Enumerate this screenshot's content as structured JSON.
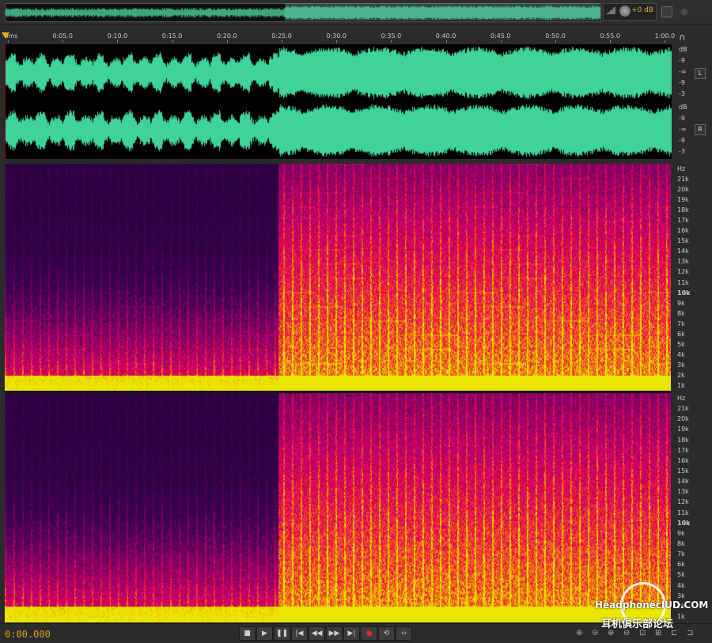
{
  "overview": {
    "volume_label": "+0 dB"
  },
  "ruler": {
    "ticks": [
      "hms",
      "0:05.0",
      "0:10.0",
      "0:15.0",
      "0:20.0",
      "0:25.0",
      "0:30.0",
      "0:35.0",
      "0:40.0",
      "0:45.0",
      "0:50.0",
      "0:55.0",
      "1:00.0"
    ]
  },
  "waveform": {
    "color": "#3fd39a",
    "db_labels": [
      "dB",
      "-9",
      "-∞",
      "-9",
      "-3"
    ],
    "left_channel": "L",
    "right_channel": "R"
  },
  "spectrogram": {
    "hz_labels": [
      "Hz",
      "21k",
      "20k",
      "19k",
      "18k",
      "17k",
      "16k",
      "15k",
      "14k",
      "13k",
      "12k",
      "11k",
      "10k",
      "9k",
      "8k",
      "7k",
      "6k",
      "5k",
      "4k",
      "3k",
      "2k",
      "1k"
    ],
    "bold_label": "10k"
  },
  "transport": {
    "timecode": "0:00.000",
    "buttons": [
      "stop",
      "play",
      "pause",
      "skip-back",
      "rewind",
      "fast-forward",
      "skip-forward",
      "record",
      "loop",
      "skip-selection"
    ]
  },
  "watermark": {
    "logo": "HeadphoneclUD.COM",
    "subtitle": "耳机俱乐部论坛"
  }
}
